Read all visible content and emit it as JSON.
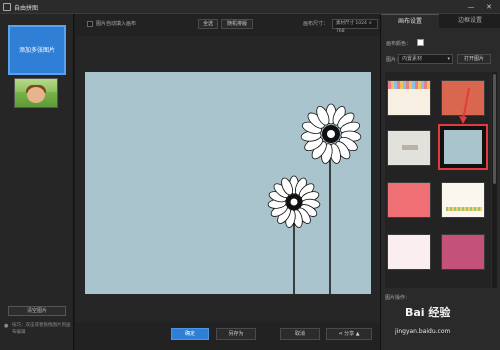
{
  "window": {
    "title": "自由拼图",
    "minimize": "—",
    "close": "✕"
  },
  "left": {
    "add_photo_label": "添加多张图片",
    "clear_label": "清空图片",
    "tip_text": "技巧：双击或者拖拽图片到画布编辑"
  },
  "toolbar": {
    "auto_fill_label": "图片自动填入画布",
    "select_all": "全选",
    "random_layout": "随机排版",
    "canvas_size_label": "画布尺寸：",
    "canvas_size_value": "素材尺寸 1024 × 768"
  },
  "bottom": {
    "confirm": "确定",
    "save_as": "另存为",
    "cancel": "取消",
    "share": "分享",
    "share_arrow": "▲"
  },
  "right": {
    "tabs": [
      "画布设置",
      "边框设置"
    ],
    "bg_color_label": "画布颜色：",
    "bg_color_value": "#ffffff",
    "image_label": "图片：",
    "image_source": "内置素材",
    "open_image": "打开图片",
    "image_ops_label": "图片操作：",
    "watermark": "Bai 经验",
    "watermark_sub": "jingyan.baidu.com"
  },
  "accent_colors": {
    "primary": "#2f7fd6",
    "selection": "#e23b3b",
    "canvas_bg": "#a9c4cc"
  }
}
